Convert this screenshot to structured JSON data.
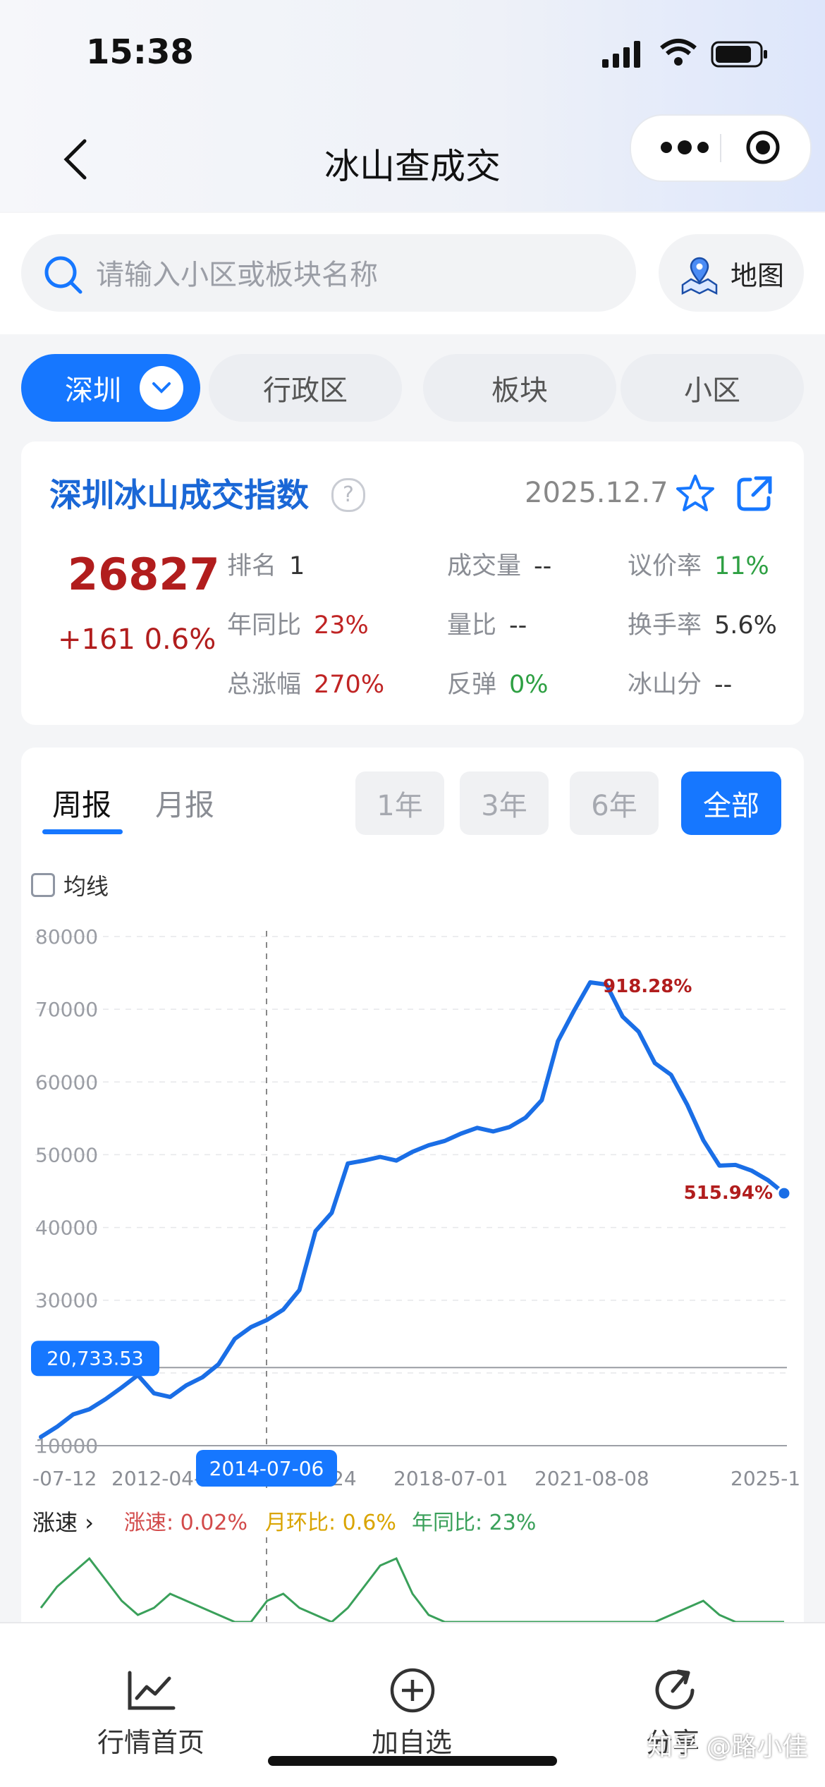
{
  "status": {
    "time": "15:38"
  },
  "header": {
    "title": "冰山查成交"
  },
  "search": {
    "placeholder": "请输入小区或板块名称",
    "map_label": "地图"
  },
  "tabs": {
    "city": "深圳",
    "district": "行政区",
    "block": "板块",
    "community": "小区"
  },
  "index_card": {
    "title": "深圳冰山成交指数",
    "date": "2025.12.7",
    "value": "26827",
    "change": "+161 0.6%",
    "metrics": [
      {
        "label": "排名",
        "value": "1",
        "tone": "dark"
      },
      {
        "label": "成交量",
        "value": "--",
        "tone": "dark"
      },
      {
        "label": "议价率",
        "value": "11%",
        "tone": "green"
      },
      {
        "label": "年同比",
        "value": "23%",
        "tone": "red"
      },
      {
        "label": "量比",
        "value": "--",
        "tone": "dark"
      },
      {
        "label": "换手率",
        "value": "5.6%",
        "tone": "dark"
      },
      {
        "label": "总涨幅",
        "value": "270%",
        "tone": "red"
      },
      {
        "label": "反弹",
        "value": "0%",
        "tone": "green"
      },
      {
        "label": "冰山分",
        "value": "--",
        "tone": "dark"
      }
    ]
  },
  "chart_panel": {
    "tab_weekly": "周报",
    "tab_monthly": "月报",
    "ranges": [
      "1年",
      "3年",
      "6年",
      "全部"
    ],
    "ma_label": "均线",
    "speed_label": "涨速",
    "speed_value": "涨速: 0.02%",
    "mom_value": "月环比: 0.6%",
    "yoy_value": "年同比: 23%"
  },
  "chart_data": {
    "type": "line",
    "y_ticks": [
      "80000",
      "70000",
      "60000",
      "50000",
      "40000",
      "30000",
      "10000"
    ],
    "x_labels": [
      "-07-12",
      "2012-04-",
      "24",
      "2018-07-01",
      "2021-08-08",
      "2025-1"
    ],
    "crosshair_date": "2014-07-06",
    "crosshair_value": "20,733.53",
    "peak_label": "918.28%",
    "end_label": "515.94%",
    "color": "#1a6ee6",
    "ylim": [
      10000,
      80000
    ],
    "x": [
      0,
      0.5,
      1,
      1.5,
      2,
      2.5,
      3,
      3.5,
      4,
      4.5,
      5,
      5.5,
      6,
      6.5,
      7,
      7.5,
      8,
      8.5,
      9,
      9.5,
      10,
      10.5,
      11,
      11.5,
      12,
      12.5,
      13,
      13.5,
      14,
      14.5,
      15,
      15.5,
      16,
      16.5,
      17,
      17.5,
      18,
      18.5,
      19,
      19.5,
      20,
      20.5,
      21,
      21.5,
      22,
      22.5,
      23
    ],
    "values": [
      11200,
      12600,
      14300,
      15000,
      16400,
      18000,
      19700,
      17200,
      16700,
      18300,
      19400,
      21200,
      24700,
      26300,
      27300,
      28700,
      31400,
      39500,
      42000,
      48800,
      49200,
      49700,
      49200,
      50400,
      51300,
      51900,
      52900,
      53700,
      53200,
      53800,
      55100,
      57500,
      65600,
      69800,
      73700,
      73400,
      69000,
      66900,
      62600,
      61000,
      56900,
      52000,
      48500,
      48600,
      47800,
      46500,
      44700
    ],
    "speed_series": [
      2,
      5,
      7,
      9,
      6,
      3,
      1,
      2,
      4,
      3,
      2,
      1,
      0,
      0,
      3,
      4,
      2,
      1,
      0,
      2,
      5,
      8,
      9,
      4,
      1,
      0,
      0,
      0,
      0,
      0,
      0,
      0,
      0,
      0,
      0,
      0,
      0,
      0,
      0,
      1,
      2,
      3,
      1,
      0,
      0,
      0,
      0
    ]
  },
  "bottom_nav": {
    "home": "行情首页",
    "add": "加自选",
    "share": "分享"
  },
  "watermark": "知乎 @路小佳"
}
